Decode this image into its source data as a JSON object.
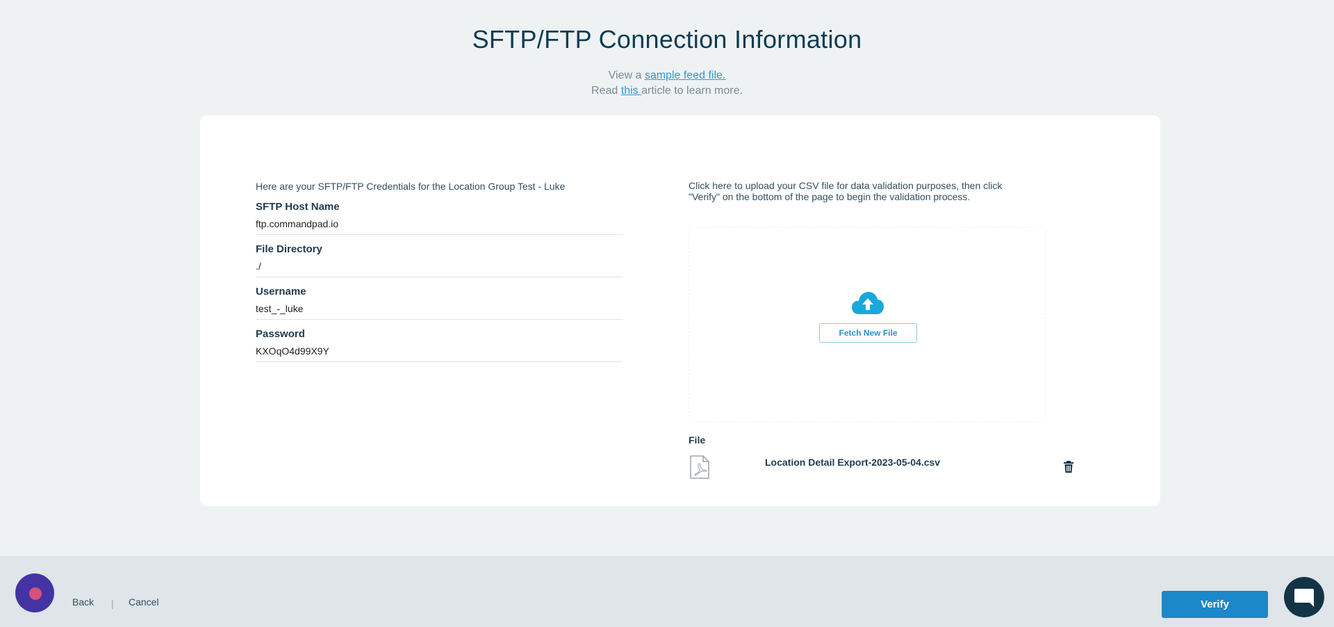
{
  "header": {
    "title": "SFTP/FTP Connection Information",
    "line1_prefix": "View a ",
    "line1_link": "sample feed file.",
    "line2_prefix": "Read ",
    "line2_link": "this ",
    "line2_suffix": "article to learn more."
  },
  "credentials": {
    "intro": "Here are your SFTP/FTP Credentials for the Location Group Test - Luke",
    "fields": [
      {
        "label": "SFTP Host Name",
        "value": "ftp.commandpad.io"
      },
      {
        "label": "File Directory",
        "value": "./"
      },
      {
        "label": "Username",
        "value": "test_-_luke"
      },
      {
        "label": "Password",
        "value": "KXOqO4d99X9Y"
      }
    ]
  },
  "upload": {
    "hint": "Click here to upload your CSV file for data validation purposes, then click \"Verify\" on the bottom of the page to begin the validation process.",
    "fetch_label": "Fetch New File",
    "file_label": "File",
    "file_name": "Location Detail Export-2023-05-04.csv"
  },
  "footer": {
    "back": "Back",
    "separator": "|",
    "cancel": "Cancel",
    "verify": "Verify"
  },
  "colors": {
    "accent": "#1a88c9",
    "title": "#0d3b54",
    "upload_icon": "#1aa8dc",
    "avatar": "#4433a3",
    "avatar_dot": "#d6517c",
    "chat": "#133447"
  },
  "icons": {
    "upload": "cloud-upload-icon",
    "file": "pdf-file-icon",
    "delete": "trash-icon",
    "chat": "chat-bubble-icon"
  }
}
